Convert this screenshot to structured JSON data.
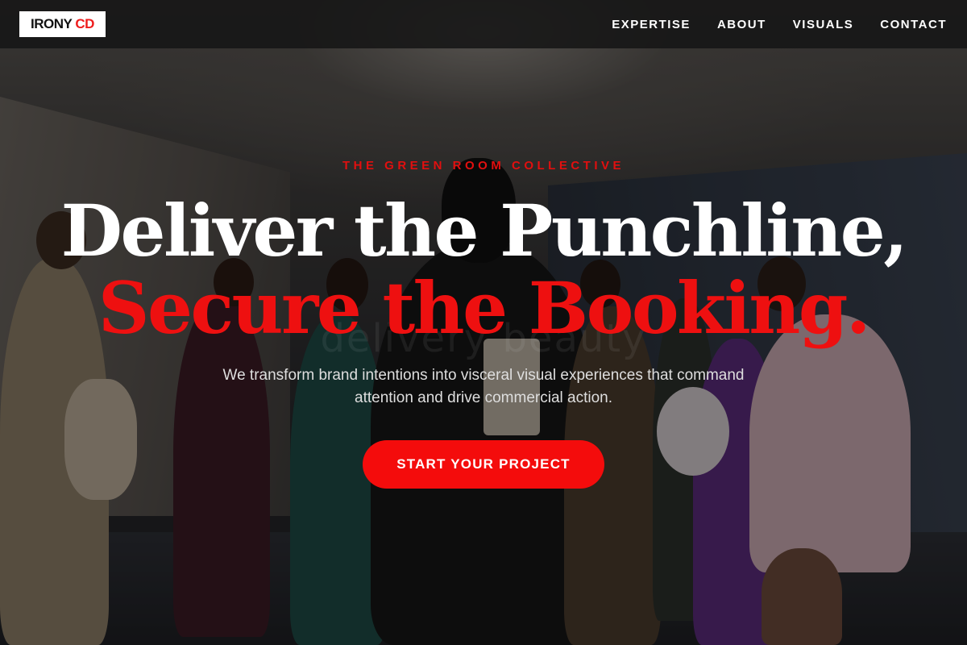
{
  "brand": {
    "logo_text_primary": "IRONY",
    "logo_text_accent": "CD",
    "accent_color": "#ee1c1c"
  },
  "nav": {
    "items": [
      {
        "label": "EXPERTISE"
      },
      {
        "label": "ABOUT"
      },
      {
        "label": "VISUALS"
      },
      {
        "label": "CONTACT"
      }
    ]
  },
  "hero": {
    "eyebrow": "THE GREEN ROOM COLLECTIVE",
    "headline_line1": "Deliver the Punchline,",
    "headline_line2": "Secure the Booking.",
    "subtext": "We transform brand intentions into visceral visual experiences that command attention and drive commercial action.",
    "cta_label": "START YOUR PROJECT",
    "background_watermark": "delivery beauty"
  }
}
